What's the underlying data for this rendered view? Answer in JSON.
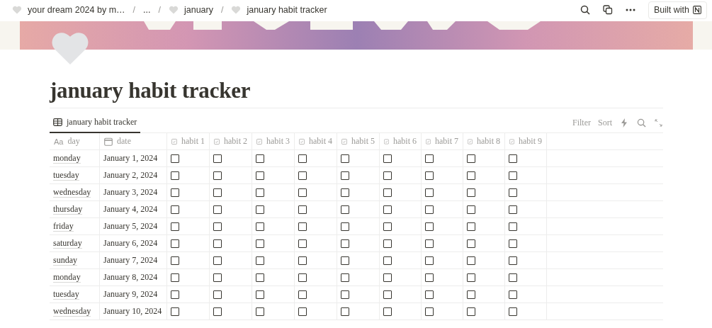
{
  "breadcrumbs": [
    {
      "kind": "link",
      "label": "your dream 2024 by m…",
      "icon": true
    },
    {
      "kind": "separator",
      "label": "/"
    },
    {
      "kind": "link",
      "label": "...",
      "icon": false
    },
    {
      "kind": "separator",
      "label": "/"
    },
    {
      "kind": "link",
      "label": "january",
      "icon": true
    },
    {
      "kind": "separator",
      "label": "/"
    },
    {
      "kind": "link",
      "label": "january habit tracker",
      "icon": true
    }
  ],
  "top_actions": {
    "built_with": "Built with"
  },
  "page": {
    "title": "january habit tracker"
  },
  "view_tab": {
    "label": "january habit tracker",
    "selected": true
  },
  "toolbar": {
    "filter": "Filter",
    "sort": "Sort"
  },
  "table": {
    "columns": [
      {
        "label": "day",
        "kind": "title",
        "icon_text": "Aa"
      },
      {
        "label": "date",
        "kind": "date"
      },
      {
        "label": "habit 1",
        "kind": "checkbox"
      },
      {
        "label": "habit 2",
        "kind": "checkbox"
      },
      {
        "label": "habit 3",
        "kind": "checkbox"
      },
      {
        "label": "habit 4",
        "kind": "checkbox"
      },
      {
        "label": "habit 5",
        "kind": "checkbox"
      },
      {
        "label": "habit 6",
        "kind": "checkbox"
      },
      {
        "label": "habit 7",
        "kind": "checkbox"
      },
      {
        "label": "habit 8",
        "kind": "checkbox"
      },
      {
        "label": "habit 9",
        "kind": "checkbox"
      }
    ],
    "rows": [
      {
        "day": "monday",
        "date": "January 1, 2024",
        "checks": [
          false,
          false,
          false,
          false,
          false,
          false,
          false,
          false,
          false
        ]
      },
      {
        "day": "tuesday",
        "date": "January 2, 2024",
        "checks": [
          false,
          false,
          false,
          false,
          false,
          false,
          false,
          false,
          false
        ]
      },
      {
        "day": "wednesday",
        "date": "January 3, 2024",
        "checks": [
          false,
          false,
          false,
          false,
          false,
          false,
          false,
          false,
          false
        ]
      },
      {
        "day": "thursday",
        "date": "January 4, 2024",
        "checks": [
          false,
          false,
          false,
          false,
          false,
          false,
          false,
          false,
          false
        ]
      },
      {
        "day": "friday",
        "date": "January 5, 2024",
        "checks": [
          false,
          false,
          false,
          false,
          false,
          false,
          false,
          false,
          false
        ]
      },
      {
        "day": "saturday",
        "date": "January 6, 2024",
        "checks": [
          false,
          false,
          false,
          false,
          false,
          false,
          false,
          false,
          false
        ]
      },
      {
        "day": "sunday",
        "date": "January 7, 2024",
        "checks": [
          false,
          false,
          false,
          false,
          false,
          false,
          false,
          false,
          false
        ]
      },
      {
        "day": "monday",
        "date": "January 8, 2024",
        "checks": [
          false,
          false,
          false,
          false,
          false,
          false,
          false,
          false,
          false
        ]
      },
      {
        "day": "tuesday",
        "date": "January 9, 2024",
        "checks": [
          false,
          false,
          false,
          false,
          false,
          false,
          false,
          false,
          false
        ]
      },
      {
        "day": "wednesday",
        "date": "January 10, 2024",
        "checks": [
          false,
          false,
          false,
          false,
          false,
          false,
          false,
          false,
          false
        ]
      }
    ]
  }
}
